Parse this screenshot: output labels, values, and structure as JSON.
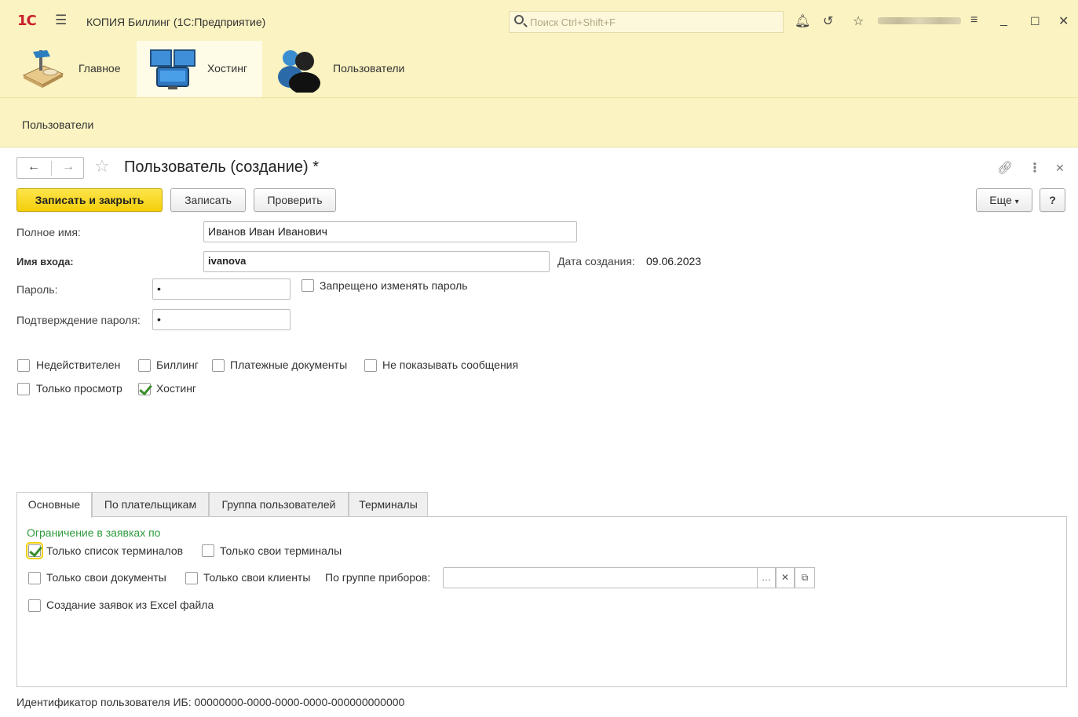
{
  "titlebar": {
    "logo": "1С",
    "title": "КОПИЯ Биллинг  (1С:Предприятие)",
    "search_placeholder": "Поиск Ctrl+Shift+F"
  },
  "sections": [
    {
      "label": "Главное"
    },
    {
      "label": "Хостинг"
    },
    {
      "label": "Пользователи"
    }
  ],
  "panel": {
    "link": "Пользователи"
  },
  "form": {
    "title": "Пользователь (создание) *",
    "buttons": {
      "save_close": "Записать и закрыть",
      "save": "Записать",
      "check": "Проверить",
      "more": "Еще",
      "help": "?"
    },
    "fields": {
      "full_name_label": "Полное имя:",
      "full_name": "Иванов Иван Иванович",
      "login_label": "Имя входа:",
      "login": "ivanova",
      "created_label": "Дата создания:",
      "created": "09.06.2023",
      "password_label": "Пароль:",
      "password": "•",
      "forbid_change_pw": "Запрещено изменять пароль",
      "confirm_label": "Подтверждение пароля:",
      "confirm": "•"
    },
    "flags": [
      {
        "label": "Недействителен",
        "checked": false
      },
      {
        "label": "Биллинг",
        "checked": false
      },
      {
        "label": "Платежные документы",
        "checked": false
      },
      {
        "label": "Не показывать сообщения",
        "checked": false
      },
      {
        "label": "Только просмотр",
        "checked": false
      },
      {
        "label": "Хостинг",
        "checked": true
      }
    ],
    "tabs": [
      {
        "label": "Основные"
      },
      {
        "label": "По плательщикам"
      },
      {
        "label": "Группа пользователей"
      },
      {
        "label": "Терминалы"
      }
    ],
    "main_tab": {
      "group_title": "Ограничение в заявках по",
      "options": [
        {
          "label": "Только список терминалов",
          "checked": true
        },
        {
          "label": "Только свои терминалы",
          "checked": false
        },
        {
          "label": "Только свои документы",
          "checked": false
        },
        {
          "label": "Только свои клиенты",
          "checked": false
        },
        {
          "label": "Создание заявок из Excel файла",
          "checked": false
        }
      ],
      "device_group_label": "По группе приборов:",
      "device_group_value": ""
    },
    "footer": "Идентификатор пользователя ИБ:  00000000-0000-0000-0000-000000000000"
  }
}
